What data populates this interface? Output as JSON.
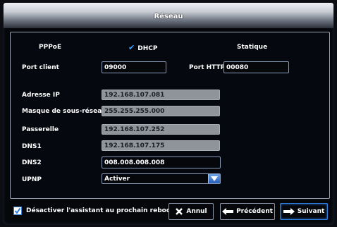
{
  "window": {
    "title": "Réseau"
  },
  "modes": {
    "pppoe": "PPPoE",
    "dhcp": "DHCP",
    "static": "Statique",
    "selected": "DHCP"
  },
  "ports": {
    "client_label": "Port client",
    "client_value": "09000",
    "http_label": "Port HTTP",
    "http_value": "00080"
  },
  "network": {
    "ip_label": "Adresse IP",
    "ip_value": "192.168.107.081",
    "mask_label": "Masque de sous-réseau",
    "mask_value": "255.255.255.000",
    "gateway_label": "Passerelle",
    "gateway_value": "192.168.107.252",
    "dns1_label": "DNS1",
    "dns1_value": "192.168.107.175",
    "dns2_label": "DNS2",
    "dns2_value": "008.008.008.008",
    "upnp_label": "UPNP",
    "upnp_value": "Activer"
  },
  "footer": {
    "disable_wizard_label": "Désactiver l'assistant au prochain reboot?",
    "disable_wizard_checked": true,
    "cancel_label": "Annul",
    "previous_label": "Précédent",
    "next_label": "Suivant"
  },
  "colors": {
    "accent": "#2f7fe0",
    "check": "#3fa0ff",
    "readonly_field": "#8f949b"
  }
}
